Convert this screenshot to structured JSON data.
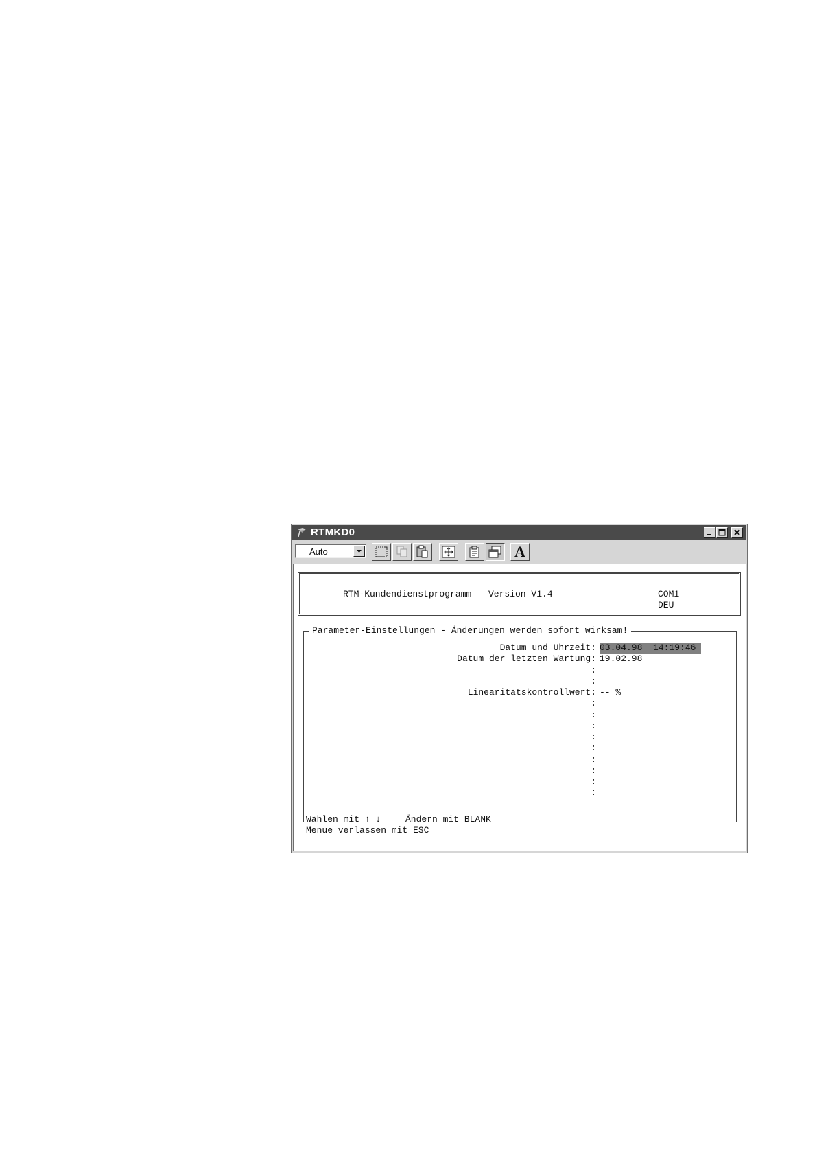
{
  "window": {
    "title": "RTMKD0",
    "controls": {
      "minimize": "_",
      "maximize": "□",
      "close": "×"
    }
  },
  "toolbar": {
    "font_size_value": "Auto",
    "font_tool_label": "A",
    "tools": [
      "mark-icon",
      "copy-icon",
      "paste-icon",
      "fullscreen-icon",
      "properties-icon",
      "background-icon",
      "font-icon"
    ]
  },
  "header": {
    "program": "RTM-Kundendienstprogramm",
    "version": "Version V1.4",
    "port": "COM1",
    "language": "DEU"
  },
  "panel": {
    "title": "Parameter-Einstellungen - Änderungen werden sofort wirksam!",
    "rows": [
      {
        "label": "Datum und Uhrzeit:",
        "value": "03.04.98  14:19:46",
        "selected": true
      },
      {
        "label": "Datum der letzten Wartung:",
        "value": "19.02.98"
      },
      {
        "label": ":",
        "value": ""
      },
      {
        "label": ":",
        "value": ""
      },
      {
        "label": "Linearitätskontrollwert:",
        "value": "-- %"
      },
      {
        "label": ":",
        "value": ""
      },
      {
        "label": ":",
        "value": ""
      },
      {
        "label": ":",
        "value": ""
      },
      {
        "label": ":",
        "value": ""
      },
      {
        "label": ":",
        "value": ""
      },
      {
        "label": ":",
        "value": ""
      },
      {
        "label": ":",
        "value": ""
      },
      {
        "label": ":",
        "value": ""
      },
      {
        "label": ":",
        "value": ""
      }
    ]
  },
  "footer": {
    "line1_select": "Wählen mit ↑ ↓",
    "line1_change": "Ändern mit BLANK",
    "line2": "Menue verlassen mit ESC"
  }
}
